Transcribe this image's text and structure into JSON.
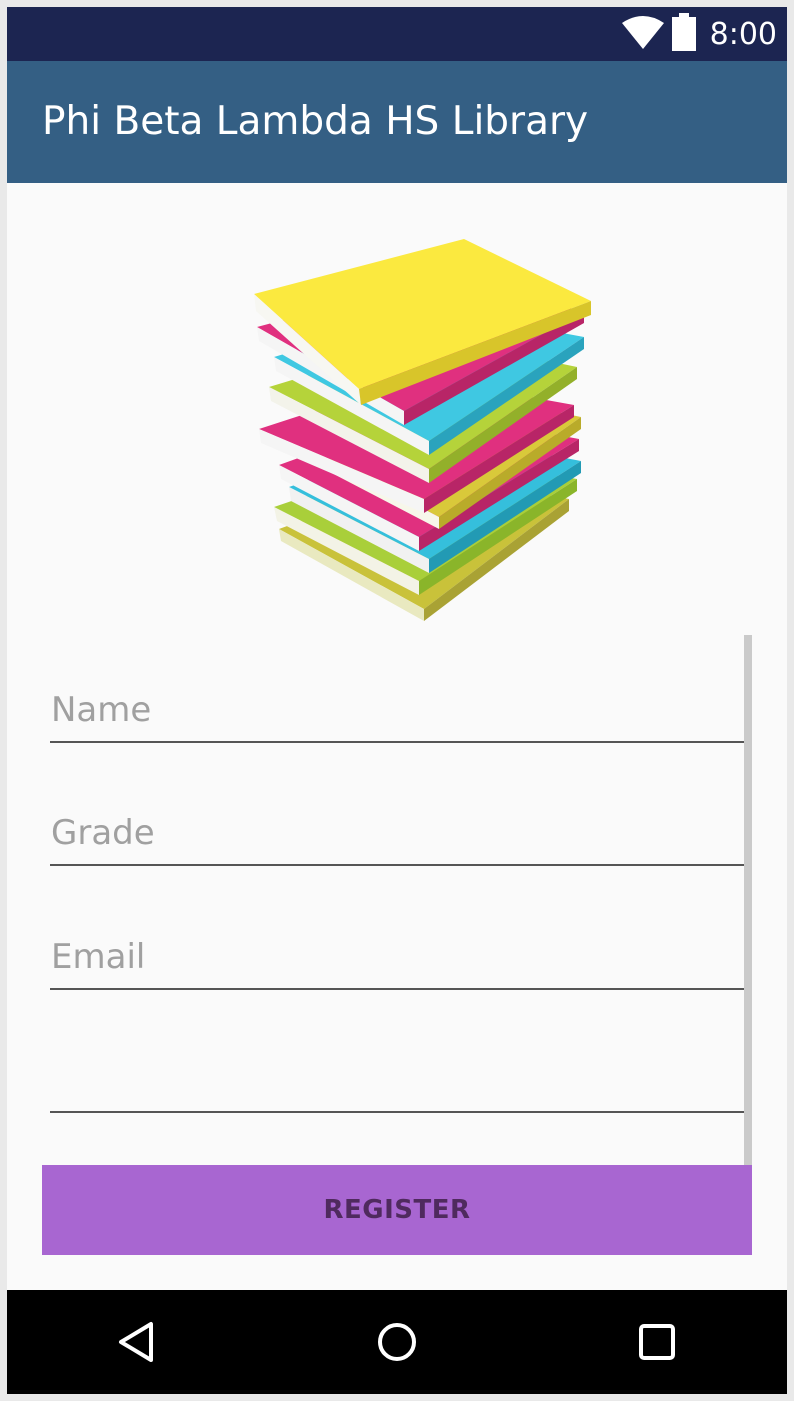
{
  "status_bar": {
    "time": "8:00",
    "icons": [
      "wifi-icon",
      "battery-icon"
    ]
  },
  "app_bar": {
    "title": "Phi Beta Lambda HS Library"
  },
  "hero": {
    "image": "stack-of-books-illustration"
  },
  "form": {
    "name_placeholder": "Name",
    "name_value": "",
    "grade_placeholder": "Grade",
    "grade_value": "",
    "email_placeholder": "Email",
    "email_value": "",
    "extra_placeholder": "",
    "extra_value": ""
  },
  "register_button": {
    "label": "REGISTER"
  },
  "nav_bar": {
    "icons": [
      "back-icon",
      "home-icon",
      "recents-icon"
    ]
  },
  "colors": {
    "status_bar": "#1c2551",
    "app_bar": "#345f84",
    "background": "#fafafa",
    "button": "#a866d1",
    "button_text": "#4f2a5e",
    "nav_bar": "#000000"
  }
}
